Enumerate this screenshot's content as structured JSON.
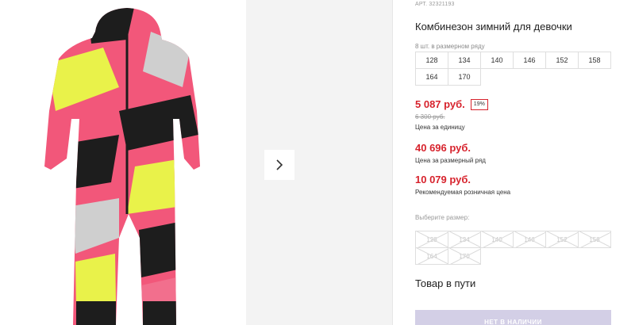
{
  "product": {
    "article": "АРТ. 32321193",
    "title": "Комбинезон зимний для девочки",
    "pack_note": "8 шт. в размерном ряду"
  },
  "sizes_row": [
    [
      "128",
      "134",
      "140",
      "146",
      "152",
      "158"
    ],
    [
      "164",
      "170"
    ]
  ],
  "pricing": {
    "unit_price": "5 087 руб.",
    "discount_badge": "19%",
    "old_price": "6 300 руб.",
    "unit_label": "Цена за единицу",
    "row_price": "40 696 руб.",
    "row_label": "Цена за размерный ряд",
    "retail_price": "10 079 руб.",
    "retail_label": "Рекомендуемая розничная цена"
  },
  "size_select": {
    "label": "Выберите размер:",
    "options": [
      [
        "128",
        "134",
        "140",
        "146",
        "152",
        "158"
      ],
      [
        "164",
        "170"
      ]
    ]
  },
  "status": "Товар в пути",
  "cta_label": "НЕТ В НАЛИЧИИ",
  "gallery": {
    "next_icon": "chevron-right-icon",
    "colors": {
      "pink": "#f2577a",
      "yellow": "#e9f24a",
      "black": "#1d1d1d",
      "grey": "#cfcfcf"
    }
  },
  "theme": {
    "price_red": "#d7232d",
    "cta_bg": "#d3cfe6"
  }
}
